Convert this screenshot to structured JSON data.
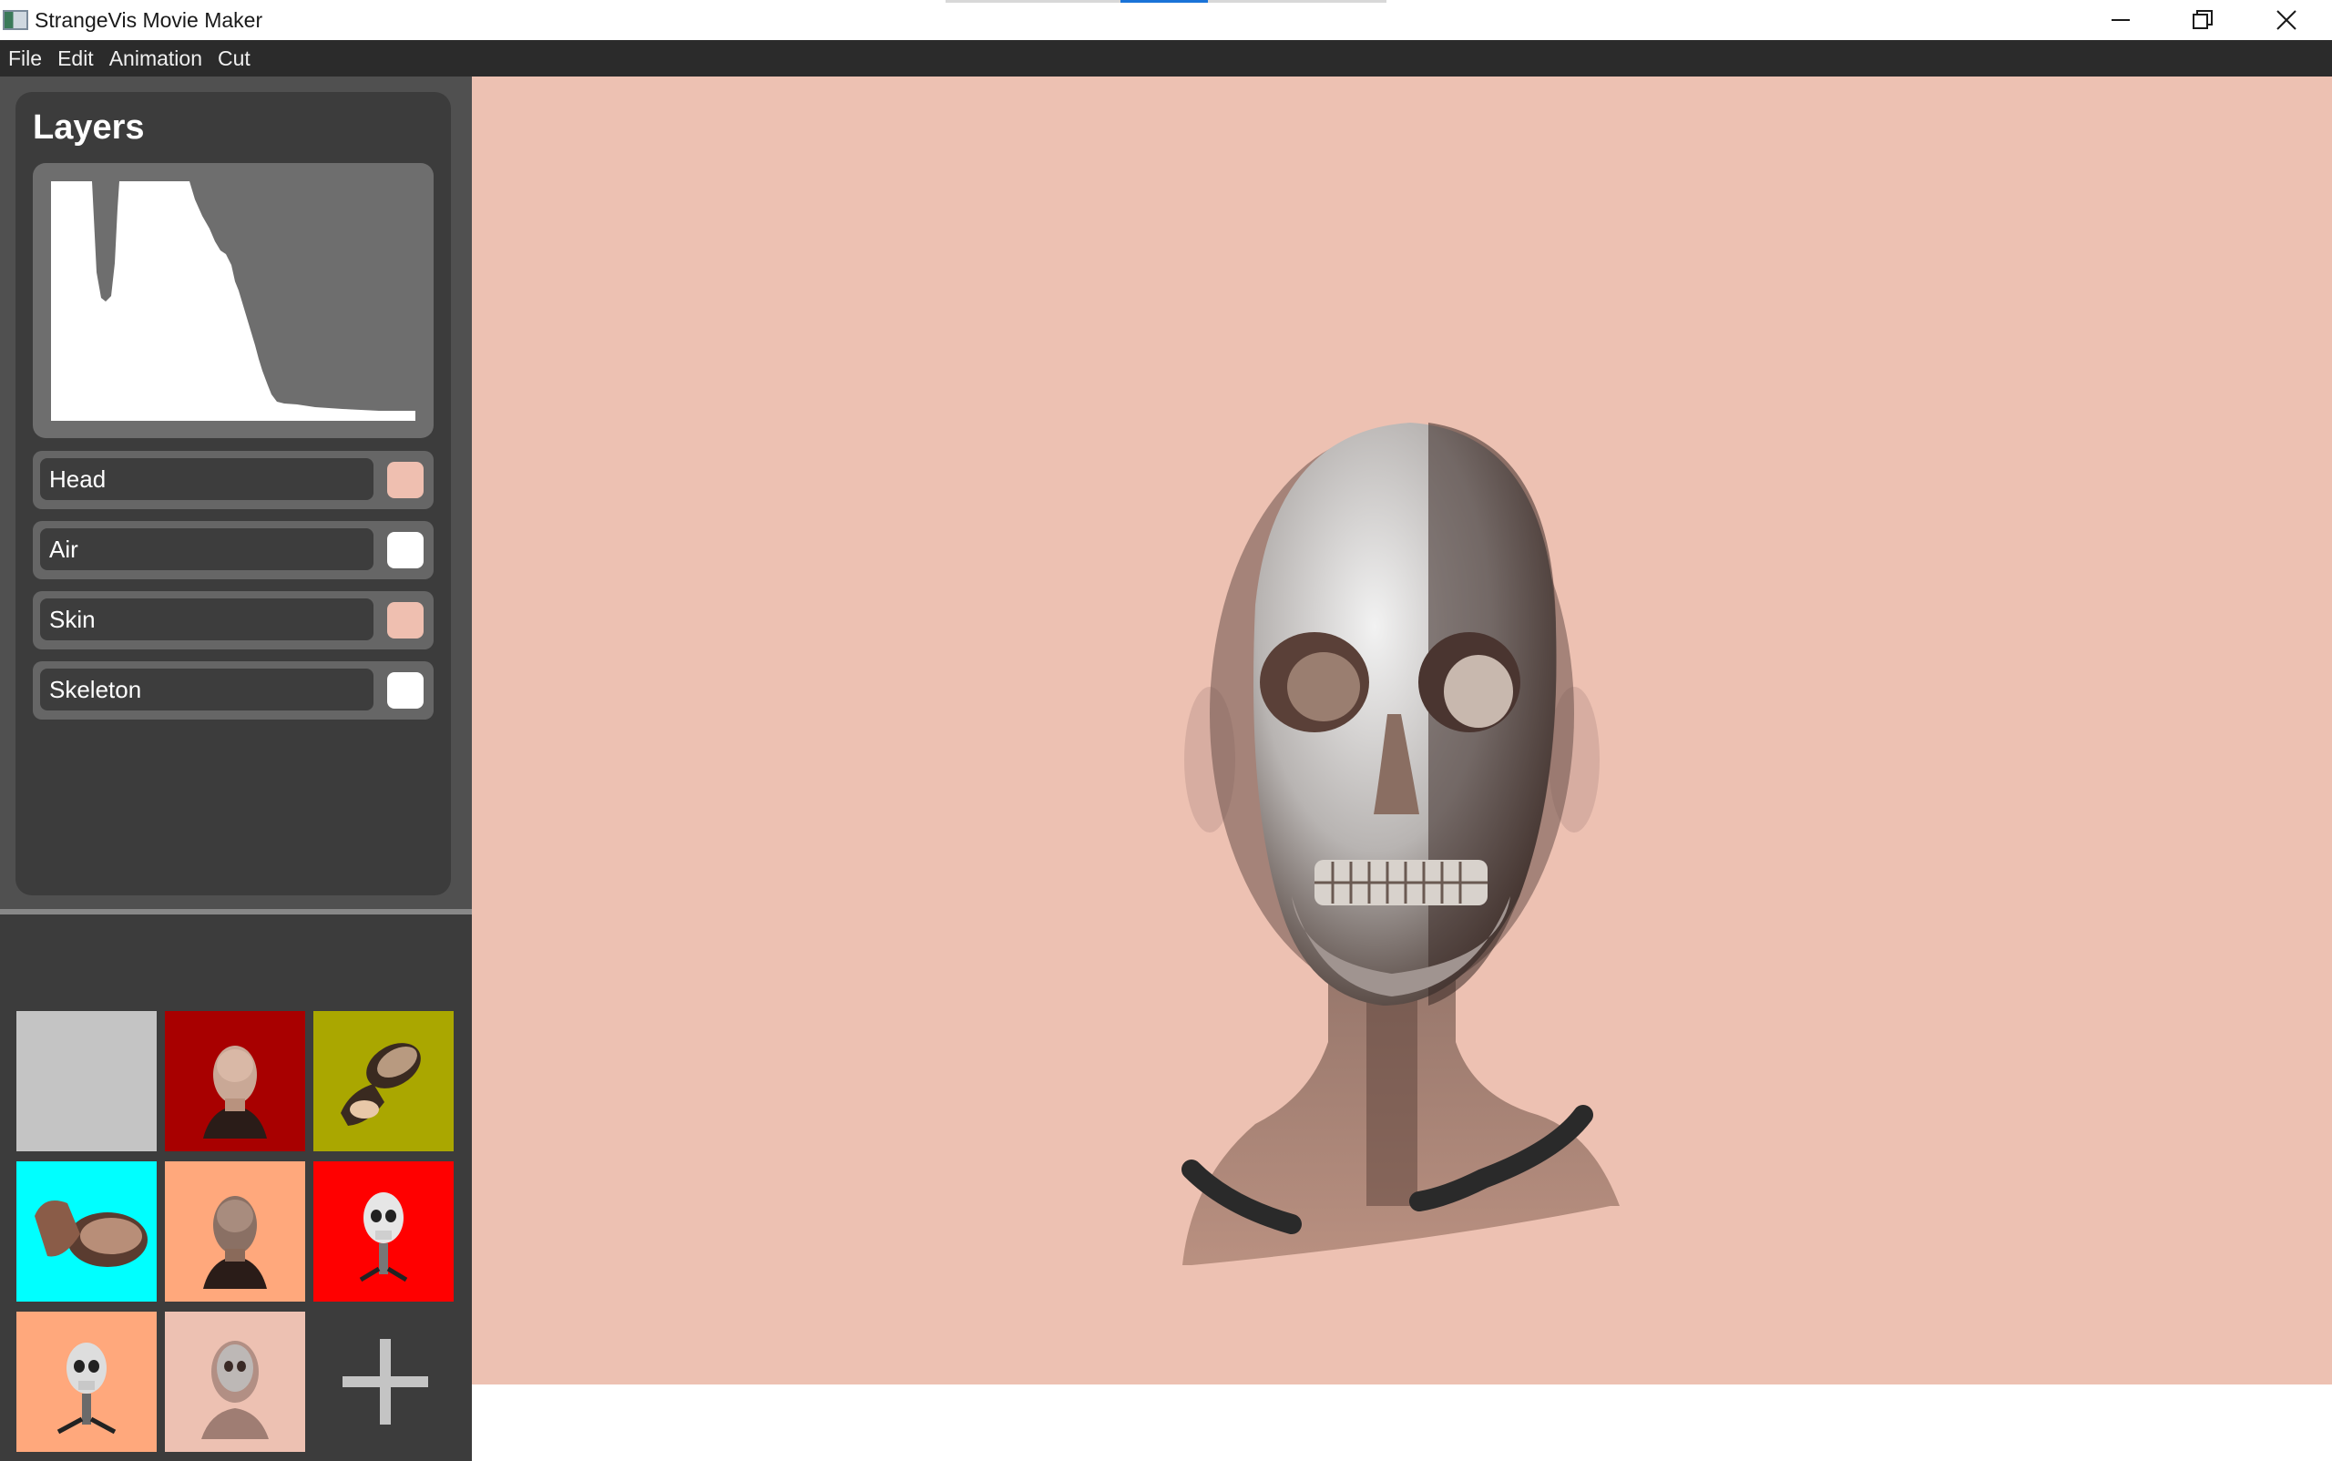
{
  "window": {
    "title": "StrangeVis Movie Maker",
    "controls": [
      "minimize",
      "restore",
      "close"
    ]
  },
  "menu": [
    "File",
    "Edit",
    "Animation",
    "Cut"
  ],
  "layers_panel": {
    "title": "Layers",
    "layers": [
      {
        "name": "Head",
        "color": "#efbfb0"
      },
      {
        "name": "Air",
        "color": "#ffffff"
      },
      {
        "name": "Skin",
        "color": "#efbfb0"
      },
      {
        "name": "Skeleton",
        "color": "#ffffff"
      }
    ]
  },
  "presets": {
    "tiles": [
      {
        "bg": "#c4c4c4",
        "content": "empty"
      },
      {
        "bg": "#a80000",
        "content": "head-front"
      },
      {
        "bg": "#aaa700",
        "content": "head-tilted"
      },
      {
        "bg": "#00ffff",
        "content": "head-sideways"
      },
      {
        "bg": "#ffa87c",
        "content": "head-front"
      },
      {
        "bg": "#ff0000",
        "content": "skull-front"
      },
      {
        "bg": "#ffa87c",
        "content": "skull-front"
      },
      {
        "bg": "#edc1b2",
        "content": "skull-translucent"
      }
    ],
    "add_icon": "plus-icon"
  },
  "viewport": {
    "background": "#edc1b2",
    "subject": "translucent-head-with-skeleton"
  }
}
